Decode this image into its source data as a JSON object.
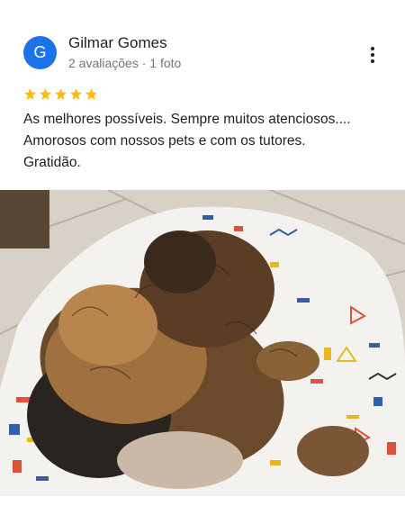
{
  "review": {
    "author": {
      "initial": "G",
      "name": "Gilmar Gomes",
      "meta": "2 avaliações · 1 foto",
      "avatar_color": "#1a73e8"
    },
    "rating": 5,
    "star_color": "#fbbc04",
    "text_lines": [
      "As melhores possíveis. Sempre muitos atenciosos....",
      "Amorosos com nossos pets e com os tutores.",
      "Gratidão."
    ],
    "more_icon": "more-vert-icon",
    "photo_description_icon": "photo"
  }
}
